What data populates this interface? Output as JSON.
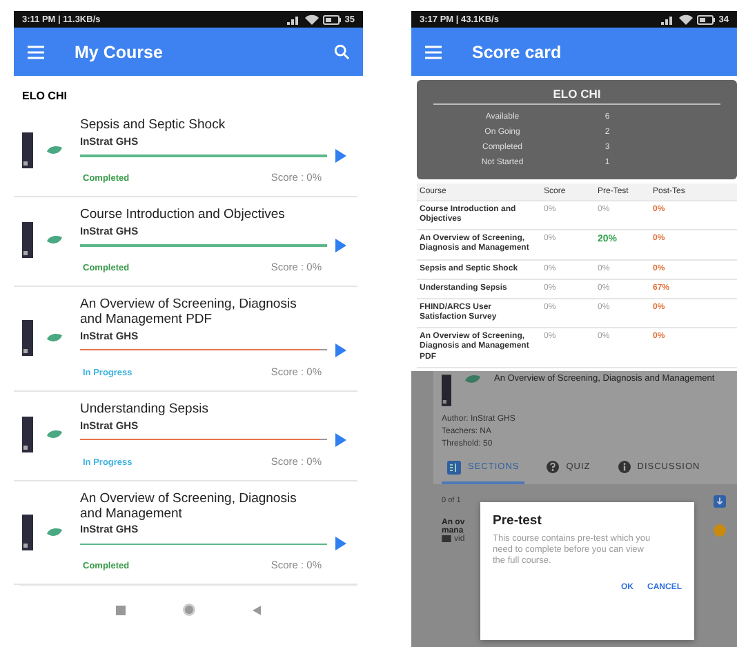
{
  "my_course": {
    "status_bar": {
      "info": "3:11 PM | 11.3KB/s",
      "battery": "35"
    },
    "title": "My Course",
    "user": "ELO CHI",
    "courses": [
      {
        "title": "Sepsis and Septic Shock",
        "provider": "InStrat GHS",
        "kind": "completed",
        "status": "Completed",
        "level": 1,
        "score": "Score : 0%"
      },
      {
        "title": "Course Introduction and Objectives",
        "provider": "InStrat GHS",
        "kind": "completed",
        "status": "Completed",
        "level": 1,
        "score": "Score : 0%"
      },
      {
        "title": "An Overview of Screening, Diagnosis and Management PDF",
        "provider": "InStrat GHS",
        "kind": "progress",
        "status": "In Progress",
        "level": 0.97,
        "score": "Score : 0%"
      },
      {
        "title": "Understanding Sepsis",
        "provider": "InStrat GHS",
        "kind": "progress",
        "status": "In Progress",
        "level": 0.97,
        "score": "Score : 0%"
      },
      {
        "title": "An Overview of Screening, Diagnosis and Management",
        "provider": "InStrat GHS",
        "kind": "completed",
        "status": "Completed",
        "level": 1,
        "score": "Score : 0%"
      }
    ]
  },
  "score_card": {
    "status_bar": {
      "info": "3:17 PM | 43.1KB/s",
      "battery": "34"
    },
    "title": "Score card",
    "summary": {
      "name": "ELO CHI",
      "rows": [
        {
          "label": "Available",
          "value": "6"
        },
        {
          "label": "On Going",
          "value": "2"
        },
        {
          "label": "Completed",
          "value": "3"
        },
        {
          "label": "Not Started",
          "value": "1"
        }
      ]
    },
    "table": {
      "columns": [
        "Course",
        "Score",
        "Pre-Test",
        "Post-Tes"
      ],
      "rows": [
        {
          "course": "Course Introduction and Objectives",
          "score": "0%",
          "pre_test": "0%",
          "pre_test_passed": false,
          "post_test": "0%"
        },
        {
          "course": "An Overview of Screening, Diagnosis and Management",
          "score": "0%",
          "pre_test": "20%",
          "pre_test_passed": true,
          "post_test": "0%"
        },
        {
          "course": "Sepsis and Septic Shock",
          "score": "0%",
          "pre_test": "0%",
          "pre_test_passed": false,
          "post_test": "0%"
        },
        {
          "course": "Understanding Sepsis",
          "score": "0%",
          "pre_test": "0%",
          "pre_test_passed": false,
          "post_test": "67%"
        },
        {
          "course": "FHIND/ARCS User Satisfaction Survey",
          "score": "0%",
          "pre_test": "0%",
          "pre_test_passed": false,
          "post_test": "0%"
        },
        {
          "course": "An Overview of Screening, Diagnosis and Management PDF",
          "score": "0%",
          "pre_test": "0%",
          "pre_test_passed": false,
          "post_test": "0%"
        }
      ]
    }
  },
  "course_detail": {
    "title": "An Overview of Screening, Diagnosis and Management",
    "details": [
      "Author: InStrat GHS",
      "Teachers: NA",
      "Threshold: 50"
    ],
    "tabs": [
      {
        "label": "SECTIONS",
        "kind": "sections",
        "selected": true
      },
      {
        "label": "QUIZ",
        "kind": "quiz",
        "selected": false
      },
      {
        "label": "DISCUSSION",
        "kind": "discussion",
        "selected": false
      }
    ],
    "progress": "0 of 1",
    "item_title_lines": [
      "An ov",
      "mana"
    ],
    "item_type": "vid"
  },
  "dialog": {
    "title": "Pre-test",
    "message": "This course contains pre-test which you need to complete before you can view the full course.",
    "buttons": [
      "OK",
      "CANCEL"
    ]
  }
}
